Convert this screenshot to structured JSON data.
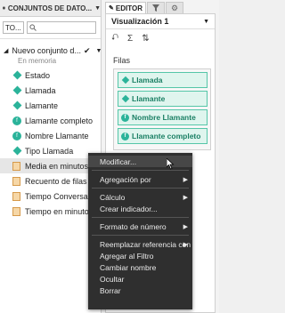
{
  "left_panel": {
    "header": "CONJUNTOS DE DATO...",
    "type_select": "TO...",
    "search_placeholder": "",
    "dataset": {
      "name": "Nuevo conjunto d...",
      "status": "En memoria"
    },
    "fields": [
      {
        "label": "Estado",
        "icon": "dimension-diamond-icon"
      },
      {
        "label": "Llamada",
        "icon": "dimension-diamond-icon"
      },
      {
        "label": "Llamante",
        "icon": "dimension-diamond-icon"
      },
      {
        "label": "Llamante completo",
        "icon": "calculated-dimension-icon"
      },
      {
        "label": "Nombre Llamante",
        "icon": "calculated-dimension-icon"
      },
      {
        "label": "Tipo Llamada",
        "icon": "dimension-diamond-icon"
      },
      {
        "label": "Media en minutos",
        "icon": "measure-icon"
      },
      {
        "label": "Recuento de filas",
        "icon": "measure-icon"
      },
      {
        "label": "Tiempo Conversa...",
        "icon": "measure-icon"
      },
      {
        "label": "Tiempo en minutos",
        "icon": "measure-icon"
      }
    ]
  },
  "right_panel": {
    "tabs": {
      "editor": "EDITOR",
      "filter_icon": "filter-icon",
      "settings_icon": "gear-icon"
    },
    "visualization_title": "Visualización 1",
    "rows_section": "Filas",
    "pills": [
      {
        "label": "Llamada",
        "icon": "dimension-diamond-icon"
      },
      {
        "label": "Llamante",
        "icon": "dimension-diamond-icon"
      },
      {
        "label": "Nombre Llamante",
        "icon": "calculated-dimension-icon"
      },
      {
        "label": "Llamante completo",
        "icon": "calculated-dimension-icon"
      }
    ]
  },
  "context_menu": {
    "items": [
      {
        "label": "Modificar...",
        "submenu": false,
        "highlighted": true
      },
      {
        "sep": true
      },
      {
        "label": "Agregación por",
        "submenu": true
      },
      {
        "sep": true
      },
      {
        "label": "Cálculo",
        "submenu": true
      },
      {
        "label": "Crear indicador...",
        "submenu": false
      },
      {
        "sep": true
      },
      {
        "label": "Formato de número",
        "submenu": true
      },
      {
        "sep": true
      },
      {
        "label": "Reemplazar referencia con",
        "submenu": true
      },
      {
        "label": "Agregar al Filtro",
        "submenu": false
      },
      {
        "label": "Cambiar nombre",
        "submenu": false
      },
      {
        "label": "Ocultar",
        "submenu": false
      },
      {
        "label": "Borrar",
        "submenu": false
      }
    ]
  },
  "colors": {
    "dimension": "#2bb39a",
    "pill_bg": "#dff5ee",
    "menu_bg": "#2f2f2f",
    "measure": "#f6d7a7"
  }
}
